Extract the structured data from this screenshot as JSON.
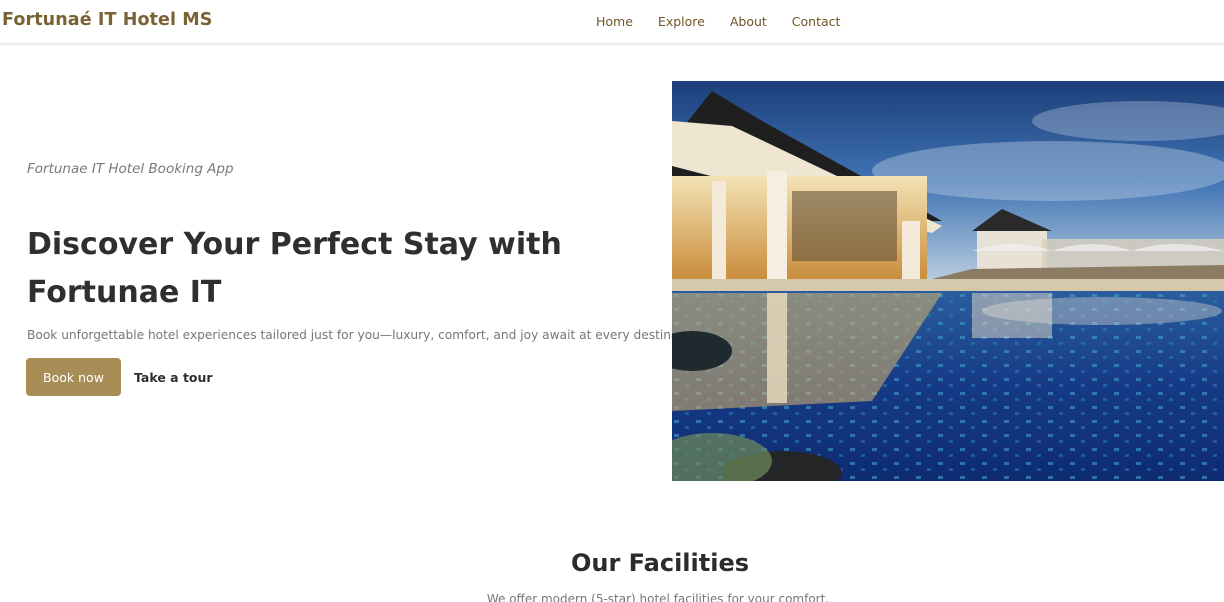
{
  "brand": {
    "name": "Fortunaé IT Hotel MS",
    "color": "#7a6234"
  },
  "nav": {
    "items": [
      {
        "label": "Home"
      },
      {
        "label": "Explore"
      },
      {
        "label": "About"
      },
      {
        "label": "Contact"
      }
    ]
  },
  "hero": {
    "eyebrow": "Fortunae IT Hotel Booking App",
    "title": "Discover Your Perfect Stay with Fortunae IT",
    "subtitle": "Book unforgettable hotel experiences tailored just for you—luxury, comfort, and joy await at every destination",
    "primary_button": "Book now",
    "secondary_button": "Take a tour",
    "accent_color": "#a98d56"
  },
  "facilities": {
    "title": "Our Facilities",
    "subtitle": "We offer modern (5-star) hotel facilities for your comfort."
  }
}
